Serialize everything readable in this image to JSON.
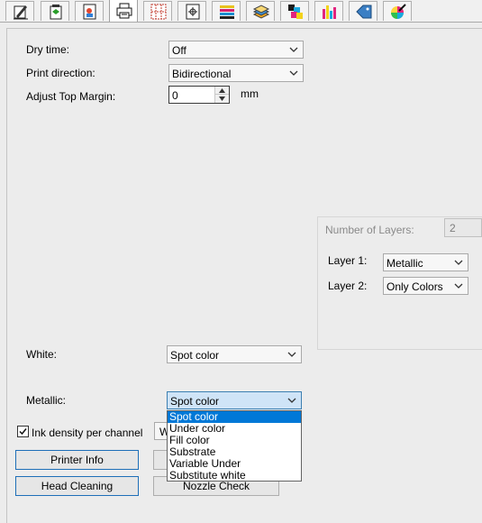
{
  "tabs": [
    {
      "name": "tab-general",
      "icon": "paper-pencil-icon"
    },
    {
      "name": "tab-media",
      "icon": "media-feed-icon"
    },
    {
      "name": "tab-image",
      "icon": "image-page-icon"
    },
    {
      "name": "tab-printer",
      "icon": "printer-icon",
      "active": true
    },
    {
      "name": "tab-layout",
      "icon": "grid-layout-icon"
    },
    {
      "name": "tab-position",
      "icon": "page-target-icon"
    },
    {
      "name": "tab-color",
      "icon": "color-bars-icon"
    },
    {
      "name": "tab-layers",
      "icon": "layer-stack-icon"
    },
    {
      "name": "tab-cmyk",
      "icon": "cmyk-squares-icon"
    },
    {
      "name": "tab-ink",
      "icon": "ink-bars-icon"
    },
    {
      "name": "tab-tag",
      "icon": "blue-tag-icon"
    },
    {
      "name": "tab-color-picker",
      "icon": "color-picker-icon"
    }
  ],
  "settings": {
    "dry_time": {
      "label": "Dry time:",
      "value": "Off"
    },
    "print_direction": {
      "label": "Print direction:",
      "value": "Bidirectional"
    },
    "top_margin": {
      "label": "Adjust Top Margin:",
      "value": "0",
      "unit": "mm"
    }
  },
  "layers": {
    "count_label": "Number of Layers:",
    "count_value": "2",
    "layer1": {
      "label": "Layer 1:",
      "value": "Metallic"
    },
    "layer2": {
      "label": "Layer 2:",
      "value": "Only Colors"
    }
  },
  "white": {
    "label": "White:",
    "value": "Spot color"
  },
  "metallic": {
    "label": "Metallic:",
    "value": "Spot color",
    "options": [
      "Spot color",
      "Under color",
      "Fill color",
      "Substrate",
      "Variable Under",
      "Substitute white"
    ],
    "highlighted": 0
  },
  "ink_density": {
    "label": "Ink density per channel",
    "checked": true,
    "partial_combo_text": "W"
  },
  "buttons": {
    "printer_info": "Printer Info",
    "head_cleaning": "Head Cleaning",
    "nozzle_check": "Nozzle Check"
  },
  "colors": {
    "accent": "#0078d7",
    "focus_border": "#3c7fb1",
    "focus_bg": "#cfe4f7"
  }
}
